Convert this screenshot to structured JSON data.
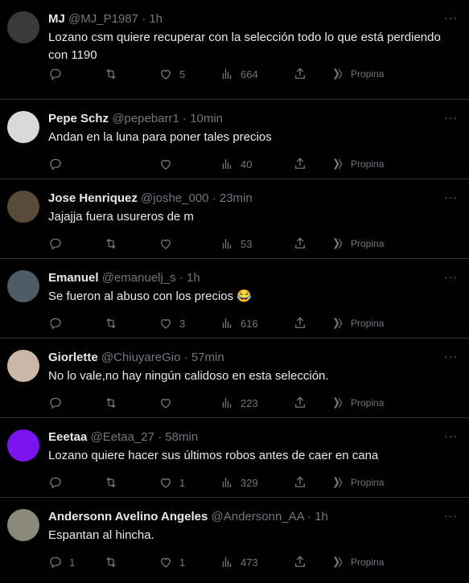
{
  "tweets": [
    {
      "name": "MJ",
      "handle": "@MJ_P1987",
      "time": "1h",
      "text": "Lozano csm quiere recuperar con la selección todo lo que está perdiendo con 1190",
      "replies": "",
      "retweets": "",
      "likes": "5",
      "views": "664",
      "tip": "Propina",
      "more": "···",
      "avatar_color": "#3a3a3a",
      "show_rt": true,
      "show_reply_count": false
    },
    {
      "name": "Pepe Schz",
      "handle": "@pepebarr1",
      "time": "10min",
      "text": "Andan en la luna para poner tales precios",
      "replies": "",
      "retweets": "",
      "likes": "",
      "views": "40",
      "tip": "Propina",
      "more": "···",
      "avatar_color": "#d9d9d9",
      "show_rt": false
    },
    {
      "name": "Jose Henriquez",
      "handle": "@joshe_000",
      "time": "23min",
      "text": "Jajajja fuera usureros de m",
      "replies": "",
      "retweets": "",
      "likes": "",
      "views": "53",
      "tip": "Propina",
      "more": "···",
      "avatar_color": "#5a4a3a",
      "show_rt": true
    },
    {
      "name": "Emanuel",
      "handle": "@emanuelj_s",
      "time": "1h",
      "text": "Se fueron al abuso con los precios 😂",
      "replies": "",
      "retweets": "",
      "likes": "3",
      "views": "616",
      "tip": "Propina",
      "more": "···",
      "avatar_color": "#4d5b66",
      "show_rt": true
    },
    {
      "name": "Giorlette",
      "handle": "@ChiuyareGio",
      "time": "57min",
      "text": "No lo vale,no hay ningún calidoso en esta selección.",
      "replies": "",
      "retweets": "",
      "likes": "",
      "views": "223",
      "tip": "Propina",
      "more": "···",
      "avatar_color": "#c9b8a8",
      "show_rt": true
    },
    {
      "name": "Eeetaa",
      "handle": "@Eetaa_27",
      "time": "58min",
      "text": "Lozano quiere hacer sus últimos robos antes de caer en cana",
      "replies": "",
      "retweets": "",
      "likes": "1",
      "views": "329",
      "tip": "Propina",
      "more": "···",
      "avatar_color": "#7b14f0",
      "show_rt": true
    },
    {
      "name": "Andersonn Avelino Angeles",
      "handle": "@Andersonn_AA",
      "time": "1h",
      "text": "Espantan al hincha.",
      "replies": "1",
      "retweets": "",
      "likes": "1",
      "views": "473",
      "tip": "Propina",
      "more": "···",
      "avatar_color": "#8a8a7a",
      "show_rt": true
    }
  ]
}
